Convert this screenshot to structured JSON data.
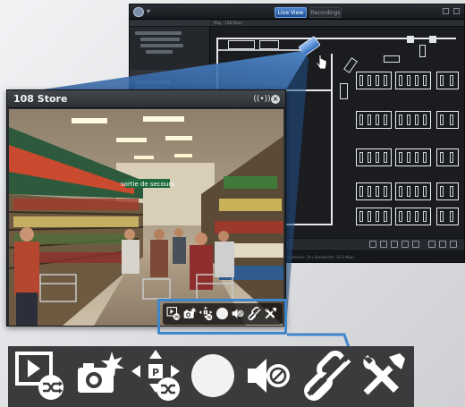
{
  "app": {
    "tabs": [
      {
        "label": "Live View",
        "selected": true
      },
      {
        "label": "Recordings",
        "selected": false
      }
    ],
    "map_title": "Map - 108 Store",
    "status": "CPU: 12% | RAM: 3.2 GB | Cameras: 24 | Bandwidth: 18.4 Mbps"
  },
  "live_window": {
    "title": "108 Store",
    "feed_sign": "sortie de secours"
  },
  "toolbar": {
    "items": [
      {
        "name": "switch-stream-icon"
      },
      {
        "name": "snapshot-icon"
      },
      {
        "name": "ptz-control-icon"
      },
      {
        "name": "record-icon"
      },
      {
        "name": "audio-mute-icon"
      },
      {
        "name": "disconnect-icon"
      },
      {
        "name": "settings-icon"
      }
    ]
  },
  "colors": {
    "accent": "#3f86cb",
    "toolbar_bg": "#3a3b3d",
    "app_bg": "#1d2024"
  }
}
